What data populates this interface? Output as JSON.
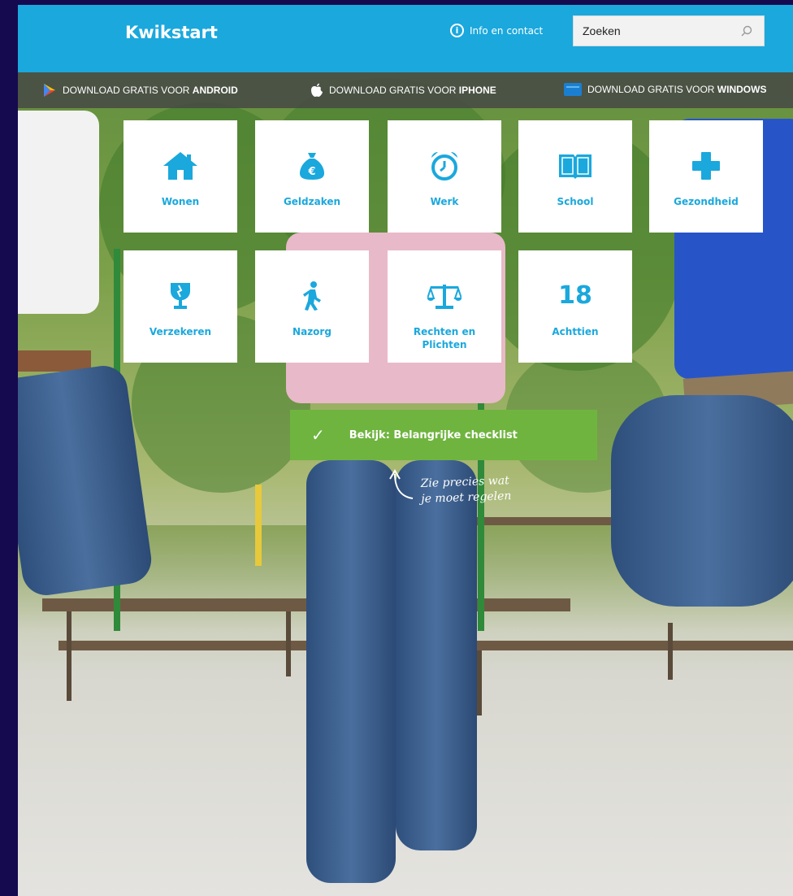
{
  "header": {
    "logo": "Kwikstart",
    "info_label": "Info en contact",
    "info_icon": "info-icon",
    "search_placeholder": "Zoeken",
    "search_icon": "magnifier-icon"
  },
  "downloads": [
    {
      "prefix": "DOWNLOAD GRATIS VOOR ",
      "platform": "ANDROID",
      "icon": "google-play-icon"
    },
    {
      "prefix": "DOWNLOAD GRATIS VOOR ",
      "platform": "IPHONE",
      "icon": "apple-icon"
    },
    {
      "prefix": "DOWNLOAD GRATIS VOOR ",
      "platform": "WINDOWS",
      "icon": "windows-icon"
    }
  ],
  "tiles": [
    {
      "label": "Wonen",
      "icon": "house-icon"
    },
    {
      "label": "Geldzaken",
      "icon": "money-bag-icon"
    },
    {
      "label": "Werk",
      "icon": "alarm-clock-icon"
    },
    {
      "label": "School",
      "icon": "book-icon"
    },
    {
      "label": "Gezondheid",
      "icon": "medical-cross-icon"
    },
    {
      "label": "Verzekeren",
      "icon": "fragile-glass-icon"
    },
    {
      "label": "Nazorg",
      "icon": "walking-person-icon"
    },
    {
      "label": "Rechten en Plichten",
      "icon": "scales-icon"
    },
    {
      "label": "Achttien",
      "icon": "eighteen-icon",
      "number": "18"
    }
  ],
  "checklist": {
    "label": "Bekijk: Belangrijke checklist",
    "icon": "checkmark-icon"
  },
  "hint": {
    "line1": "Zie precies wat",
    "line2": "je moet regelen"
  },
  "colors": {
    "brand_blue": "#1aa8dd",
    "checklist_green": "#6fb43f",
    "download_bar": "#464646",
    "outer_background": "#150a4f"
  }
}
